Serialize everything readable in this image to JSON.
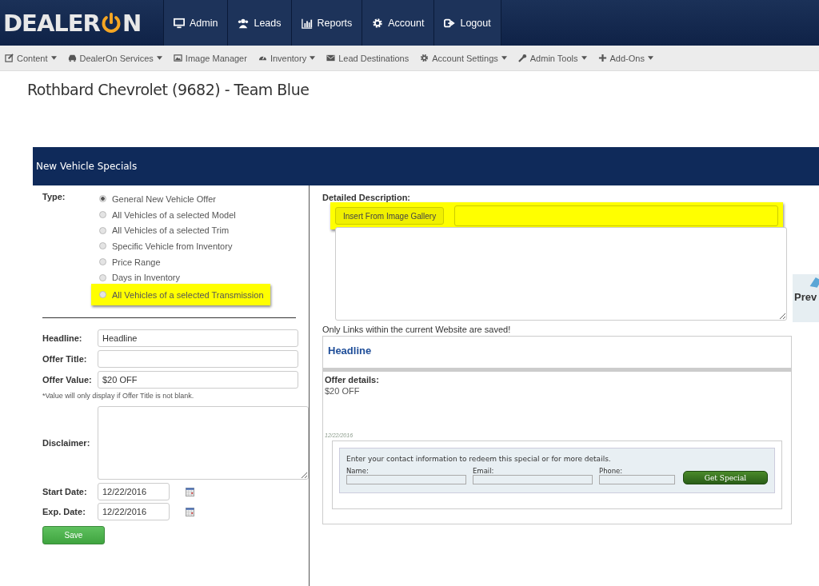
{
  "logo": {
    "left": "DEALER",
    "right": "N"
  },
  "top_nav": [
    {
      "label": "Admin"
    },
    {
      "label": "Leads"
    },
    {
      "label": "Reports"
    },
    {
      "label": "Account"
    },
    {
      "label": "Logout"
    }
  ],
  "sub_nav": [
    {
      "label": "Content",
      "dropdown": true
    },
    {
      "label": "DealerOn Services",
      "dropdown": true
    },
    {
      "label": "Image Manager",
      "dropdown": false
    },
    {
      "label": "Inventory",
      "dropdown": true
    },
    {
      "label": "Lead Destinations",
      "dropdown": false
    },
    {
      "label": "Account Settings",
      "dropdown": true
    },
    {
      "label": "Admin Tools",
      "dropdown": true
    },
    {
      "label": "Add-Ons",
      "dropdown": true
    }
  ],
  "page_title": "Rothbard Chevrolet (9682) - Team Blue",
  "panel_title": "New Vehicle Specials",
  "type": {
    "label": "Type:",
    "options": [
      {
        "label": "General New Vehicle Offer",
        "selected": true,
        "highlighted": false
      },
      {
        "label": "All Vehicles of a selected Model",
        "selected": false,
        "highlighted": false
      },
      {
        "label": "All Vehicles of a selected Trim",
        "selected": false,
        "highlighted": false
      },
      {
        "label": "Specific Vehicle from Inventory",
        "selected": false,
        "highlighted": false
      },
      {
        "label": "Price Range",
        "selected": false,
        "highlighted": false
      },
      {
        "label": "Days in Inventory",
        "selected": false,
        "highlighted": false
      },
      {
        "label": "All Vehicles of a selected Transmission",
        "selected": false,
        "highlighted": true
      }
    ]
  },
  "fields": [
    {
      "label": "Headline:",
      "value": "Headline"
    },
    {
      "label": "Offer Title:"
    },
    {
      "label": "Offer Value:",
      "value": "$20 OFF"
    }
  ],
  "note": "*Value will only display if Offer Title is not blank.",
  "disclaimer": {
    "label": "Disclaimer:"
  },
  "dates": [
    {
      "label": "Start Date:",
      "value": "12/22/2016"
    },
    {
      "label": "Exp. Date:",
      "value": "12/22/2016"
    }
  ],
  "save_button": "Save",
  "description": {
    "label": "Detailed Description:",
    "gallery_button": "Insert From Image Gallery",
    "highlighted": true
  },
  "links_note": "Only Links within the current Website are saved!",
  "preview": {
    "headline": "Headline",
    "details_label": "Offer details:",
    "details": "$20 OFF",
    "date": "12/22/2016",
    "form": {
      "prompt": "Enter your contact information to redeem this special or for more details.",
      "fields": [
        "Name:",
        "Email:",
        "Phone:"
      ],
      "button": "Get Special"
    }
  },
  "preview_button": "Prev"
}
